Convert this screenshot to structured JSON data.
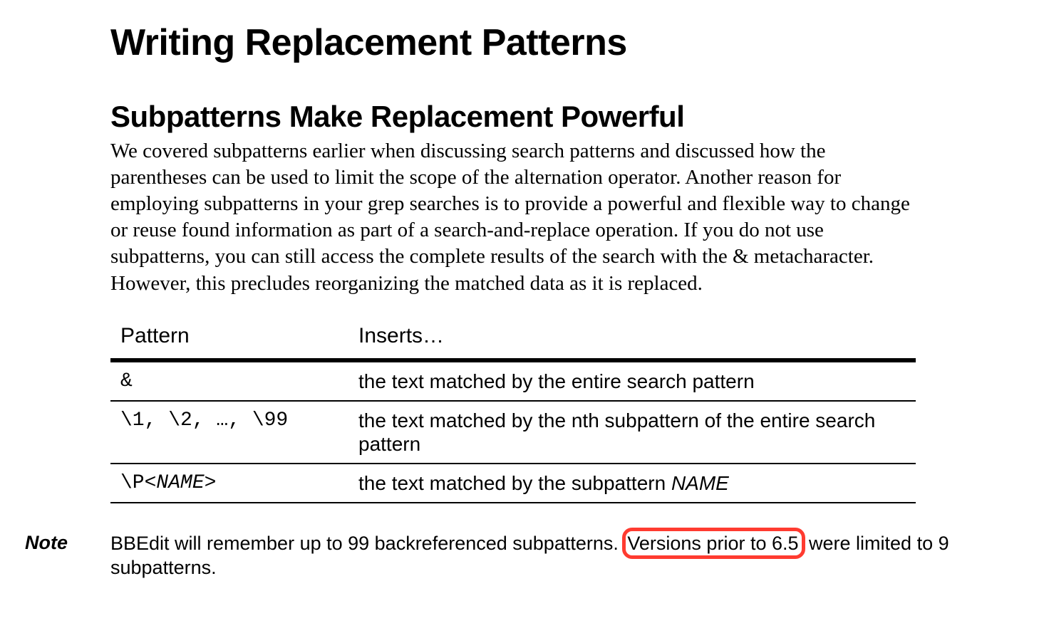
{
  "headings": {
    "title": "Writing Replacement Patterns",
    "subtitle": "Subpatterns Make Replacement Powerful"
  },
  "paragraph": "We covered subpatterns earlier when discussing search patterns and discussed how the parentheses can be used to limit the scope of the alternation operator. Another reason for employing subpatterns in your grep searches is to provide a powerful and flexible way to change or reuse found information as part of a search-and-replace operation. If you do not use subpatterns, you can still access the complete results of the search with the & metacharacter. However, this precludes reorganizing the matched data as it is replaced.",
  "table": {
    "headers": {
      "col1": "Pattern",
      "col2": "Inserts…"
    },
    "rows": {
      "r0": {
        "pattern": "&",
        "inserts": "the text matched by the entire search pattern"
      },
      "r1": {
        "pattern": "\\1, \\2, …, \\99",
        "inserts": "the text matched by the nth subpattern of the entire search pattern"
      },
      "r2": {
        "pattern_prefix": "\\P<",
        "pattern_name": "NAME",
        "pattern_suffix": ">",
        "inserts_prefix": "the text matched by the subpattern ",
        "inserts_name": "NAME"
      }
    }
  },
  "note": {
    "label": "Note",
    "text_before": "BBEdit will remember up to 99 backreferenced subpatterns. ",
    "highlighted": "Versions prior to 6.5",
    "text_after": " were limited to 9 subpatterns."
  }
}
